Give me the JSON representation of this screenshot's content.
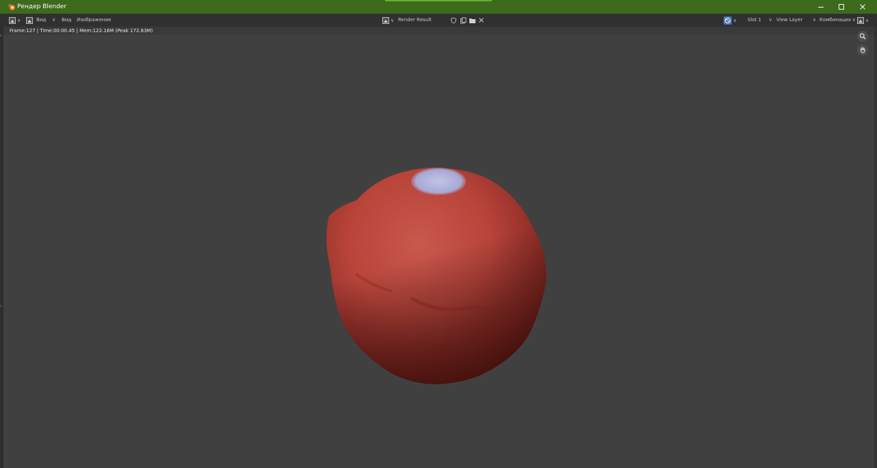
{
  "window": {
    "title": "Рендер Blender",
    "accent_color": "#3d6a1c"
  },
  "header": {
    "menu": {
      "view_1": "Вид",
      "view_2": "Вид",
      "image": "Изображение"
    },
    "image_name": "Render Result",
    "slot": "Slot 1",
    "view_layer": "View Layer",
    "pass": "Комбинация"
  },
  "status": {
    "text": "Frame:127 | Time:00:00.45 | Mem:122.16M (Peak 172.63M)"
  },
  "icons": {
    "app": "blender-icon",
    "editor_type": "image-editor-icon",
    "image_browse": "image-browse-icon",
    "fake_user": "shield-icon",
    "new_image": "new-image-icon",
    "open_image": "folder-icon",
    "unlink": "close-icon",
    "sync": "globe-icon",
    "display_mode": "display-channels-icon",
    "zoom": "zoom-icon",
    "pan": "hand-icon"
  }
}
